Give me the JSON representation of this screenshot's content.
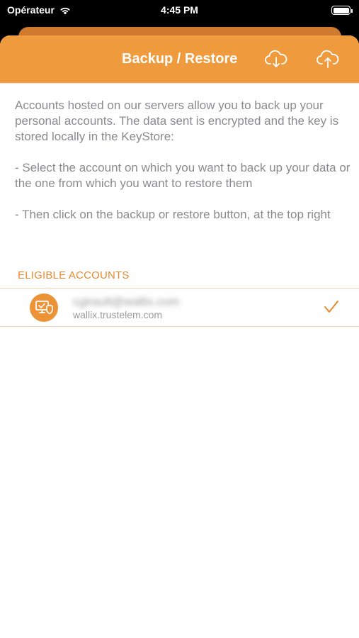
{
  "status_bar": {
    "carrier": "Opérateur",
    "time": "4:45 PM"
  },
  "nav": {
    "title": "Backup / Restore",
    "restore_icon": "cloud-download-icon",
    "backup_icon": "cloud-upload-icon"
  },
  "description": {
    "paragraphs": [
      "Accounts hosted on our servers allow you to back up your personal accounts. The data sent is encrypted and the key is stored locally in the KeyStore:",
      "- Select the account on which you want to back up your data or the one from which you want to restore them",
      "- Then click on the backup or restore button, at the top right"
    ]
  },
  "accounts": {
    "section_title": "ELIGIBLE ACCOUNTS",
    "items": [
      {
        "email": "cgirault@wallix.com",
        "host": "wallix.trustelem.com",
        "selected": true,
        "icon": "devices-shield-icon"
      }
    ]
  },
  "colors": {
    "accent": "#f09a3e",
    "section_text": "#e8892f",
    "body_text": "#8a8a8f"
  }
}
